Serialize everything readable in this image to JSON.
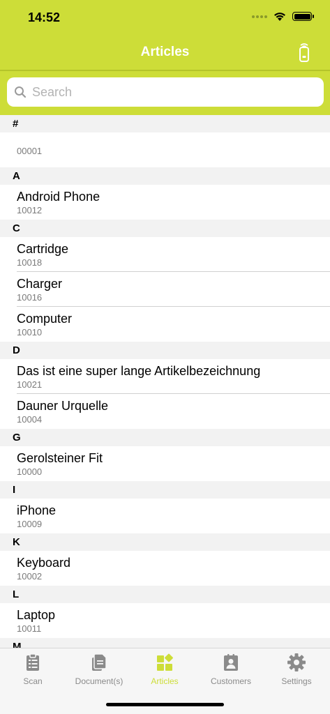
{
  "status_bar": {
    "time": "14:52"
  },
  "nav": {
    "title": "Articles"
  },
  "search": {
    "placeholder": "Search"
  },
  "sections": [
    {
      "letter": "#",
      "items": [
        {
          "name": "",
          "code": "00001"
        }
      ]
    },
    {
      "letter": "A",
      "items": [
        {
          "name": "Android Phone",
          "code": "10012"
        }
      ]
    },
    {
      "letter": "C",
      "items": [
        {
          "name": "Cartridge",
          "code": "10018"
        },
        {
          "name": "Charger",
          "code": "10016"
        },
        {
          "name": "Computer",
          "code": "10010"
        }
      ]
    },
    {
      "letter": "D",
      "items": [
        {
          "name": "Das ist eine super lange Artikelbezeichnung",
          "code": "10021"
        },
        {
          "name": "Dauner Urquelle",
          "code": "10004"
        }
      ]
    },
    {
      "letter": "G",
      "items": [
        {
          "name": "Gerolsteiner Fit",
          "code": "10000"
        }
      ]
    },
    {
      "letter": "I",
      "items": [
        {
          "name": "iPhone",
          "code": "10009"
        }
      ]
    },
    {
      "letter": "K",
      "items": [
        {
          "name": "Keyboard",
          "code": "10002"
        }
      ]
    },
    {
      "letter": "L",
      "items": [
        {
          "name": "Laptop",
          "code": "10011"
        }
      ]
    },
    {
      "letter": "M",
      "items": []
    }
  ],
  "tabs": [
    {
      "label": "Scan",
      "icon": "clipboard-list-icon",
      "active": false
    },
    {
      "label": "Document(s)",
      "icon": "documents-icon",
      "active": false
    },
    {
      "label": "Articles",
      "icon": "articles-grid-icon",
      "active": true
    },
    {
      "label": "Customers",
      "icon": "contact-card-icon",
      "active": false
    },
    {
      "label": "Settings",
      "icon": "gear-icon",
      "active": false
    }
  ],
  "colors": {
    "brand": "#cddd38",
    "header_text": "#ffffff",
    "inactive_tab": "#8a8a8a"
  }
}
